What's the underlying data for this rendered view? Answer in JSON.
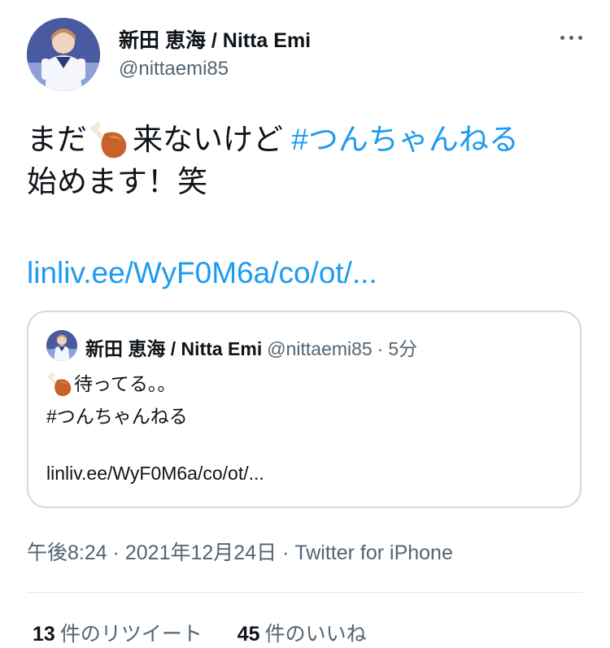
{
  "author": {
    "display_name": "新田 恵海 / Nitta Emi",
    "handle": "@nittaemi85"
  },
  "tweet": {
    "line1_prefix": "まだ",
    "line1_emoji": "poultry-leg-emoji",
    "line1_middle": "来ないけど",
    "hashtag": "#つんちゃんねる",
    "line2": "始めます！笑",
    "link": "linliv.ee/WyF0M6a/co/ot/..."
  },
  "quote": {
    "display_name": "新田 恵海 / Nitta Emi",
    "handle": "@nittaemi85",
    "separator": "·",
    "time": "5分",
    "line1_emoji": "poultry-leg-emoji",
    "line1_text": "待ってる。。",
    "line2": " #つんちゃんねる",
    "link": "linliv.ee/WyF0M6a/co/ot/..."
  },
  "meta": {
    "text": "午後8:24 · 2021年12月24日 · Twitter for iPhone"
  },
  "stats": {
    "retweets_count": "13",
    "retweets_label": "件のリツイート",
    "likes_count": "45",
    "likes_label": "件のいいね"
  },
  "colors": {
    "link": "#1d9bf0",
    "secondary_text": "#536471",
    "border": "#cfd9de"
  }
}
